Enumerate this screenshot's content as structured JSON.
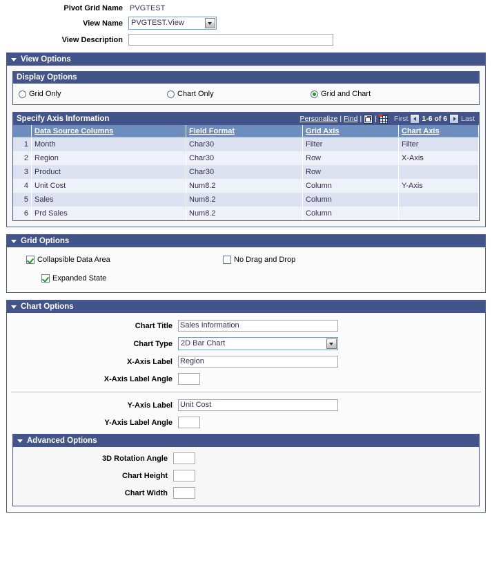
{
  "top_form": {
    "pivot_grid_name_label": "Pivot Grid Name",
    "pivot_grid_name_value": "PVGTEST",
    "view_name_label": "View Name",
    "view_name_value": "PVGTEST.View",
    "view_description_label": "View Description",
    "view_description_value": "",
    "view_description_placeholder": ""
  },
  "view_options": {
    "title": "View Options",
    "display_options": {
      "title": "Display Options",
      "radios": [
        {
          "label": "Grid Only",
          "selected": false
        },
        {
          "label": "Chart Only",
          "selected": false
        },
        {
          "label": "Grid and Chart",
          "selected": true
        }
      ]
    },
    "axis_grid": {
      "title": "Specify Axis Information",
      "personalize_label": "Personalize",
      "find_label": "Find",
      "separator": "|",
      "zoom_icon": "view-all-icon",
      "download_icon": "download-to-spreadsheet-icon",
      "first_label": "First",
      "last_label": "Last",
      "range_label": "1-6 of 6",
      "columns": [
        "",
        "Data Source Columns",
        "Field Format",
        "Grid Axis",
        "Chart Axis"
      ],
      "rows": [
        {
          "num": "1",
          "data_source_column": "Month",
          "field_format": "Char30",
          "grid_axis": "Filter",
          "chart_axis": "Filter"
        },
        {
          "num": "2",
          "data_source_column": "Region",
          "field_format": "Char30",
          "grid_axis": "Row",
          "chart_axis": "X-Axis"
        },
        {
          "num": "3",
          "data_source_column": "Product",
          "field_format": "Char30",
          "grid_axis": "Row",
          "chart_axis": ""
        },
        {
          "num": "4",
          "data_source_column": "Unit Cost",
          "field_format": "Num8.2",
          "grid_axis": "Column",
          "chart_axis": "Y-Axis"
        },
        {
          "num": "5",
          "data_source_column": "Sales",
          "field_format": "Num8.2",
          "grid_axis": "Column",
          "chart_axis": ""
        },
        {
          "num": "6",
          "data_source_column": "Prd Sales",
          "field_format": "Num8.2",
          "grid_axis": "Column",
          "chart_axis": ""
        }
      ]
    }
  },
  "grid_options": {
    "title": "Grid Options",
    "collapsible_data_area": {
      "label": "Collapsible Data Area",
      "checked": true
    },
    "no_drag_and_drop": {
      "label": "No Drag and Drop",
      "checked": false
    },
    "expanded_state": {
      "label": "Expanded State",
      "checked": true
    }
  },
  "chart_options": {
    "title": "Chart Options",
    "chart_title_label": "Chart Title",
    "chart_title_value": "Sales Information",
    "chart_type_label": "Chart Type",
    "chart_type_value": "2D Bar Chart",
    "x_axis_label_label": "X-Axis Label",
    "x_axis_label_value": "Region",
    "x_axis_label_angle_label": "X-Axis Label Angle",
    "x_axis_label_angle_value": "",
    "y_axis_label_label": "Y-Axis Label",
    "y_axis_label_value": "Unit Cost",
    "y_axis_label_angle_label": "Y-Axis Label Angle",
    "y_axis_label_angle_value": "",
    "advanced": {
      "title": "Advanced Options",
      "rotation_angle_label": "3D Rotation Angle",
      "rotation_angle_value": "",
      "chart_height_label": "Chart Height",
      "chart_height_value": "",
      "chart_width_label": "Chart Width",
      "chart_width_value": ""
    }
  }
}
